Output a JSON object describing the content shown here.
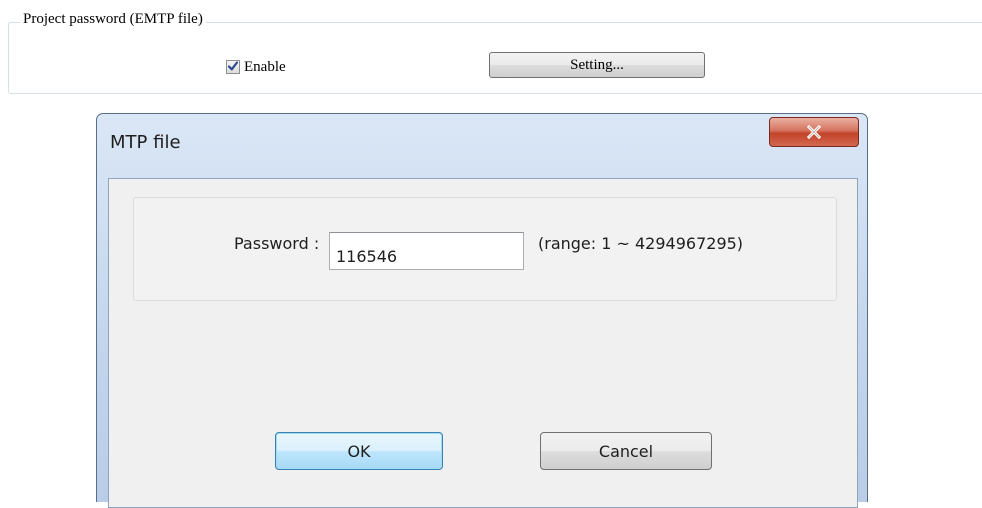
{
  "project_group": {
    "legend": "Project password (EMTP file)",
    "enable_label": "Enable",
    "enable_checked": true,
    "setting_label": "Setting..."
  },
  "dialog": {
    "title": "MTP file",
    "close_symbol": "X",
    "password_label": "Password :",
    "password_value": "116546",
    "range_text": "(range: 1 ~ 4294967295)",
    "ok_label": "OK",
    "cancel_label": "Cancel"
  },
  "colors": {
    "checkbox_tick": "#2c4a8c",
    "close_button": "#c7462c"
  },
  "icons": {
    "check": "checkmark-icon",
    "close": "close-icon"
  }
}
